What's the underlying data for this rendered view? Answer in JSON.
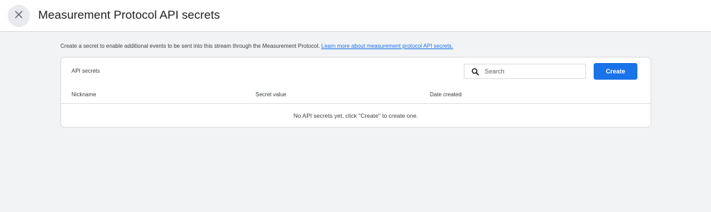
{
  "header": {
    "title": "Measurement Protocol API secrets",
    "close_icon": "close-icon"
  },
  "description": {
    "text": "Create a secret to enable additional events to be sent into this stream through the Measurement Protocol.",
    "link_text": "Learn more about measurement protocol API secrets."
  },
  "card": {
    "title": "API secrets",
    "search": {
      "placeholder": "Search",
      "value": "",
      "icon": "search-icon"
    },
    "create_label": "Create",
    "columns": [
      "Nickname",
      "Secret value",
      "Date created"
    ],
    "rows": [],
    "empty_message": "No API secrets yet, click \"Create\" to create one."
  },
  "colors": {
    "accent": "#1a73e8",
    "background": "#f1f3f4",
    "card": "#ffffff",
    "border": "#dadce0"
  }
}
